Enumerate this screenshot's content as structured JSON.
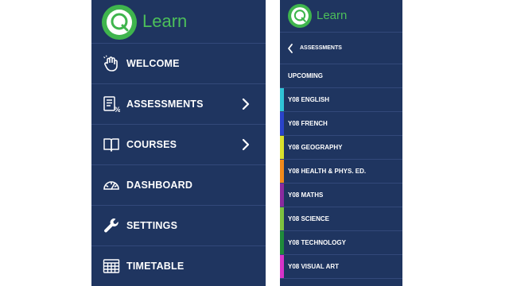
{
  "left_panel": {
    "app_title": "Learn",
    "items": [
      {
        "label": "WELCOME",
        "icon": "hand-wave-icon",
        "has_chevron": false
      },
      {
        "label": "ASSESSMENTS",
        "icon": "assessments-icon",
        "has_chevron": true
      },
      {
        "label": "COURSES",
        "icon": "book-icon",
        "has_chevron": true
      },
      {
        "label": "DASHBOARD",
        "icon": "gauge-icon",
        "has_chevron": false
      },
      {
        "label": "SETTINGS",
        "icon": "wrench-icon",
        "has_chevron": false
      },
      {
        "label": "TIMETABLE",
        "icon": "calendar-icon",
        "has_chevron": false
      }
    ]
  },
  "right_panel": {
    "app_title": "Learn",
    "back_label": "ASSESSMENTS",
    "upcoming_label": "UPCOMING",
    "courses": [
      {
        "label": "Y08 ENGLISH",
        "color": "#2fc4d6"
      },
      {
        "label": "Y08 FRENCH",
        "color": "#2a43c9"
      },
      {
        "label": "Y08 GEOGRAPHY",
        "color": "#d9e02c"
      },
      {
        "label": "Y08 HEALTH & PHYS. ED.",
        "color": "#f18a1c"
      },
      {
        "label": "Y08 MATHS",
        "color": "#8a2a9e"
      },
      {
        "label": "Y08 SCIENCE",
        "color": "#7dc23f"
      },
      {
        "label": "Y08 TECHNOLOGY",
        "color": "#1f8a3a"
      },
      {
        "label": "Y08 VISUAL ART",
        "color": "#d633c8"
      }
    ]
  },
  "colors": {
    "panel_bg": "#1f3560",
    "divider": "#33497a",
    "brand_green": "#3fb54d",
    "text": "#ffffff"
  }
}
